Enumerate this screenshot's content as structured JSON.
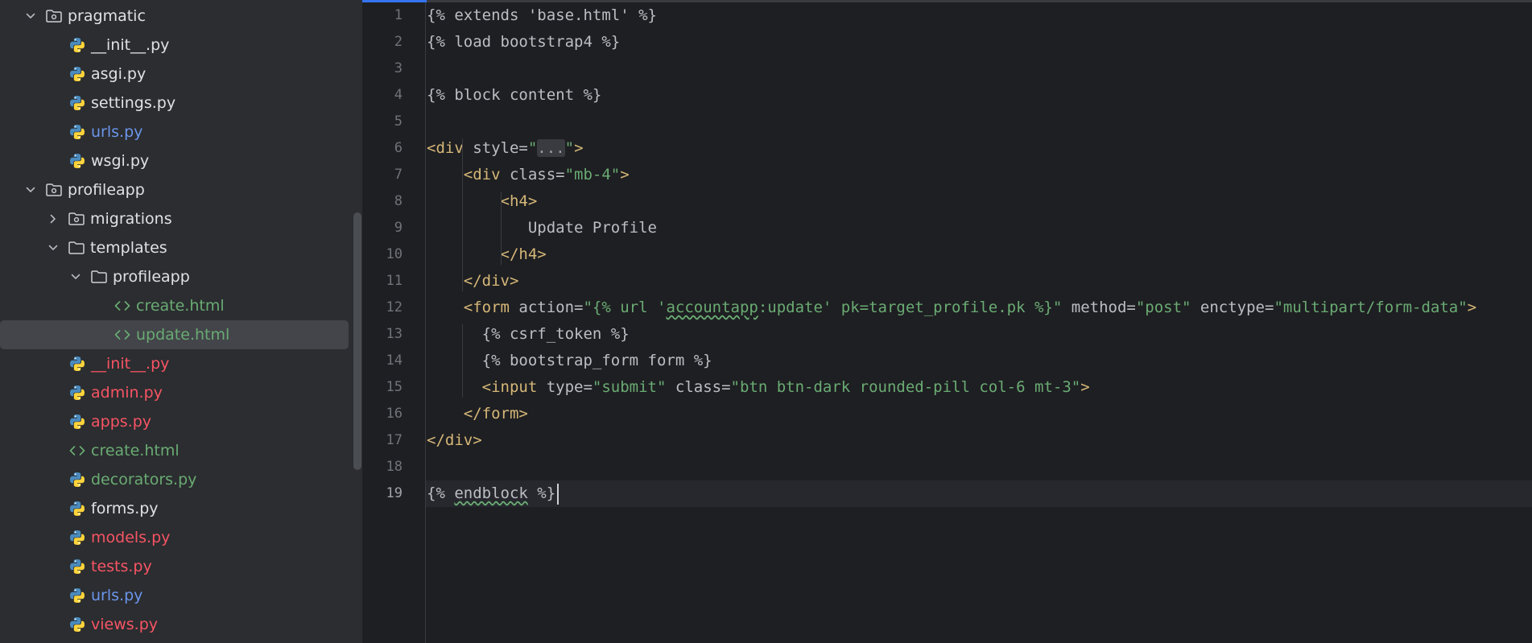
{
  "project_tree": {
    "items": [
      {
        "label": "pragmatic",
        "kind": "package",
        "depth": 0,
        "expanded": true,
        "color": "#dfe1e5"
      },
      {
        "label": "__init__.py",
        "kind": "python",
        "depth": 1,
        "color": "#dfe1e5"
      },
      {
        "label": "asgi.py",
        "kind": "python",
        "depth": 1,
        "color": "#dfe1e5"
      },
      {
        "label": "settings.py",
        "kind": "python",
        "depth": 1,
        "color": "#dfe1e5"
      },
      {
        "label": "urls.py",
        "kind": "python",
        "depth": 1,
        "color": "#6c95eb"
      },
      {
        "label": "wsgi.py",
        "kind": "python",
        "depth": 1,
        "color": "#dfe1e5"
      },
      {
        "label": "profileapp",
        "kind": "package",
        "depth": 0,
        "expanded": true,
        "color": "#dfe1e5"
      },
      {
        "label": "migrations",
        "kind": "package",
        "depth": 1,
        "expanded": false,
        "color": "#dfe1e5"
      },
      {
        "label": "templates",
        "kind": "folder",
        "depth": 1,
        "expanded": true,
        "color": "#dfe1e5"
      },
      {
        "label": "profileapp",
        "kind": "folder",
        "depth": 2,
        "expanded": true,
        "color": "#dfe1e5"
      },
      {
        "label": "create.html",
        "kind": "html",
        "depth": 3,
        "color": "#6aab73"
      },
      {
        "label": "update.html",
        "kind": "html",
        "depth": 3,
        "color": "#6aab73",
        "selected": true
      },
      {
        "label": "__init__.py",
        "kind": "python",
        "depth": 1,
        "color": "#f75464"
      },
      {
        "label": "admin.py",
        "kind": "python",
        "depth": 1,
        "color": "#f75464"
      },
      {
        "label": "apps.py",
        "kind": "python",
        "depth": 1,
        "color": "#f75464"
      },
      {
        "label": "create.html",
        "kind": "html",
        "depth": 1,
        "color": "#6aab73"
      },
      {
        "label": "decorators.py",
        "kind": "python",
        "depth": 1,
        "color": "#6aab73"
      },
      {
        "label": "forms.py",
        "kind": "python",
        "depth": 1,
        "color": "#dfe1e5"
      },
      {
        "label": "models.py",
        "kind": "python",
        "depth": 1,
        "color": "#f75464"
      },
      {
        "label": "tests.py",
        "kind": "python",
        "depth": 1,
        "color": "#f75464"
      },
      {
        "label": "urls.py",
        "kind": "python",
        "depth": 1,
        "color": "#6c95eb"
      },
      {
        "label": "views.py",
        "kind": "python",
        "depth": 1,
        "color": "#f75464"
      }
    ]
  },
  "editor": {
    "current_line": 19,
    "lines": [
      [
        {
          "t": "tmpl",
          "v": "{% extends 'base.html' %}"
        }
      ],
      [
        {
          "t": "tmpl",
          "v": "{% load bootstrap4 %}"
        }
      ],
      [],
      [
        {
          "t": "tmpl",
          "v": "{% block content %}"
        }
      ],
      [],
      [
        {
          "t": "tag",
          "v": "<div"
        },
        {
          "t": "attr",
          "v": " style="
        },
        {
          "t": "str",
          "v": "\""
        },
        {
          "t": "fold",
          "v": "..."
        },
        {
          "t": "str",
          "v": "\""
        },
        {
          "t": "tag",
          "v": ">"
        }
      ],
      [
        {
          "t": "plain",
          "v": "    "
        },
        {
          "t": "tag",
          "v": "<div"
        },
        {
          "t": "attr",
          "v": " class="
        },
        {
          "t": "str",
          "v": "\"mb-4\""
        },
        {
          "t": "tag",
          "v": ">"
        }
      ],
      [
        {
          "t": "plain",
          "v": "        "
        },
        {
          "t": "tag",
          "v": "<h4>"
        }
      ],
      [
        {
          "t": "plain",
          "v": "           Update Profile"
        }
      ],
      [
        {
          "t": "plain",
          "v": "        "
        },
        {
          "t": "tag",
          "v": "</h4>"
        }
      ],
      [
        {
          "t": "plain",
          "v": "    "
        },
        {
          "t": "tag",
          "v": "</div>"
        }
      ],
      [
        {
          "t": "plain",
          "v": "    "
        },
        {
          "t": "tag",
          "v": "<form"
        },
        {
          "t": "attr",
          "v": " action="
        },
        {
          "t": "str",
          "v": "\"{% url '"
        },
        {
          "t": "strul",
          "v": "accountapp"
        },
        {
          "t": "str",
          "v": ":update' pk=target_profile.pk %}\""
        },
        {
          "t": "attr",
          "v": " method="
        },
        {
          "t": "str",
          "v": "\"post\""
        },
        {
          "t": "attr",
          "v": " enctype="
        },
        {
          "t": "str",
          "v": "\"multipart/form-data\""
        },
        {
          "t": "tag",
          "v": ">"
        }
      ],
      [
        {
          "t": "plain",
          "v": "      {% csrf_token %}"
        }
      ],
      [
        {
          "t": "plain",
          "v": "      {% bootstrap_form form %}"
        }
      ],
      [
        {
          "t": "plain",
          "v": "      "
        },
        {
          "t": "tag",
          "v": "<input"
        },
        {
          "t": "attr",
          "v": " type="
        },
        {
          "t": "str",
          "v": "\"submit\""
        },
        {
          "t": "attr",
          "v": " class="
        },
        {
          "t": "str",
          "v": "\"btn btn-dark rounded-pill col-6 mt-3\""
        },
        {
          "t": "tag",
          "v": ">"
        }
      ],
      [
        {
          "t": "plain",
          "v": "    "
        },
        {
          "t": "tag",
          "v": "</form>"
        }
      ],
      [
        {
          "t": "tag",
          "v": "</div>"
        }
      ],
      [],
      [
        {
          "t": "tmpl",
          "v": "{% "
        },
        {
          "t": "tmplul",
          "v": "endblock"
        },
        {
          "t": "tmpl",
          "v": " %}"
        }
      ]
    ]
  }
}
